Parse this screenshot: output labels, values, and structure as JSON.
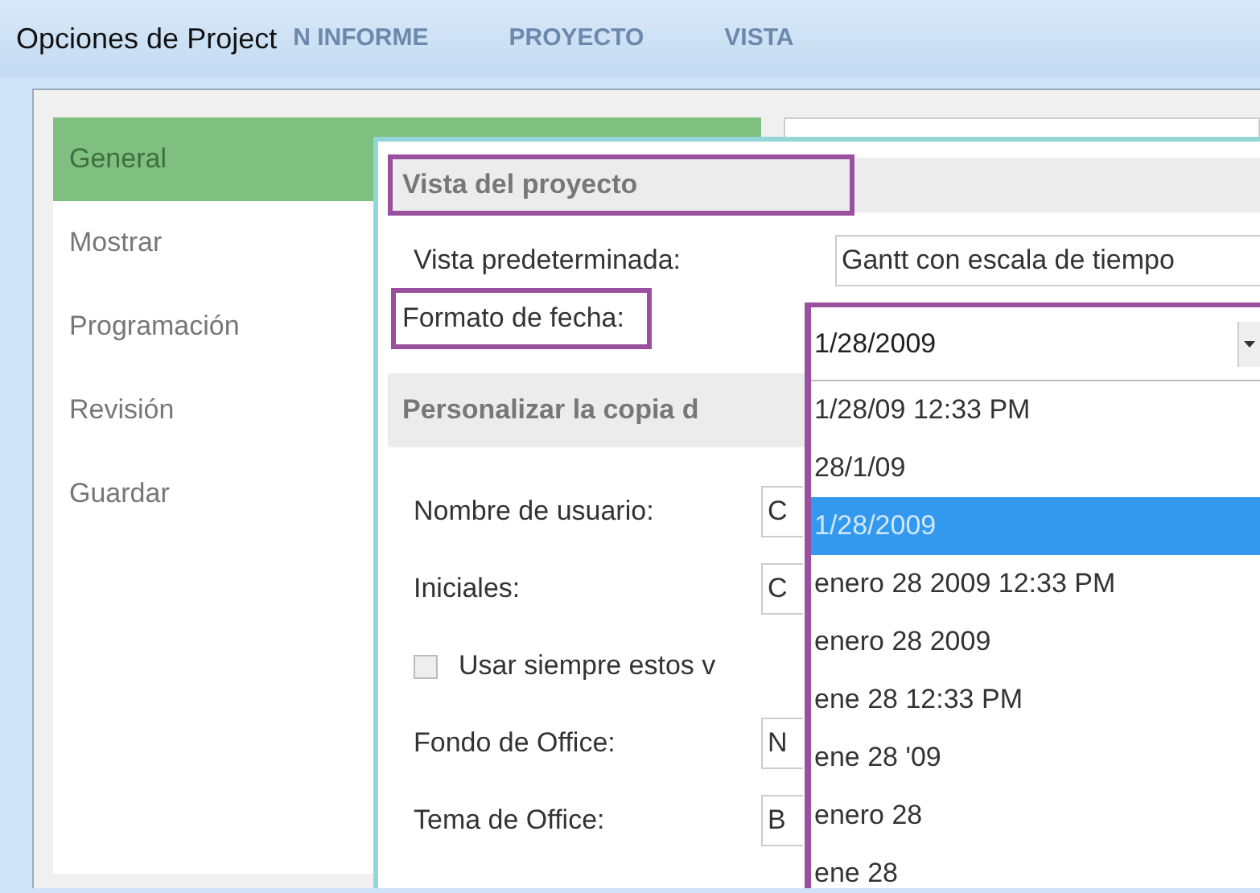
{
  "window": {
    "title": "Opciones de Project"
  },
  "ribbon_tabs": [
    "N INFORME",
    "PROYECTO",
    "VISTA"
  ],
  "sidebar": {
    "items": [
      {
        "label": "General",
        "selected": true
      },
      {
        "label": "Mostrar",
        "selected": false
      },
      {
        "label": "Programación",
        "selected": false
      },
      {
        "label": "Revisión",
        "selected": false
      },
      {
        "label": "Guardar",
        "selected": false
      }
    ]
  },
  "sections": [
    {
      "title": "Vista del proyecto",
      "highlighted": true,
      "rows": [
        {
          "kind": "select",
          "label": "Vista predeterminada:",
          "value": "Gantt con escala de tiempo",
          "highlighted": false,
          "open": false
        },
        {
          "kind": "select",
          "label": "Formato de fecha:",
          "value": "1/28/2009",
          "highlighted": true,
          "open": true,
          "options": [
            {
              "label": "1/28/09 12:33 PM",
              "selected": false
            },
            {
              "label": "28/1/09",
              "selected": false
            },
            {
              "label": "1/28/2009",
              "selected": true
            },
            {
              "label": "enero 28 2009 12:33 PM",
              "selected": false
            },
            {
              "label": "enero 28 2009",
              "selected": false
            },
            {
              "label": "ene 28 12:33 PM",
              "selected": false
            },
            {
              "label": "ene 28 '09",
              "selected": false
            },
            {
              "label": "enero 28",
              "selected": false
            },
            {
              "label": "ene 28",
              "selected": false
            }
          ]
        }
      ]
    },
    {
      "title": "Personalizar la copia d",
      "highlighted": false,
      "rows": [
        {
          "kind": "text",
          "label": "Nombre de usuario:",
          "value": "C",
          "highlighted": false
        },
        {
          "kind": "text",
          "label": "Iniciales:",
          "value": "C",
          "highlighted": false
        },
        {
          "kind": "checkbox",
          "label": "Usar siempre estos v",
          "checked": false
        },
        {
          "kind": "select",
          "label": "Fondo de Office:",
          "value": "N",
          "highlighted": false,
          "open": false
        },
        {
          "kind": "select",
          "label": "Tema de Office:",
          "value": "B",
          "highlighted": false,
          "open": false
        }
      ]
    }
  ]
}
